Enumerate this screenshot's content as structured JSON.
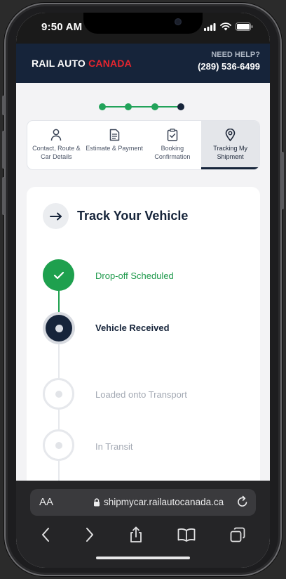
{
  "status_bar": {
    "time": "9:50 AM"
  },
  "header": {
    "logo_part1": "RAIL AUTO",
    "logo_part2": "CANADA",
    "help_label": "NEED HELP?",
    "phone": "(289) 536-6499",
    "accent_color": "#e5252f",
    "header_bg": "#16243a"
  },
  "progress": {
    "total_steps": 4,
    "current_step": 4
  },
  "steps": [
    {
      "label": "Contact, Route & Car Details",
      "icon": "person-icon"
    },
    {
      "label": "Estimate & Payment",
      "icon": "document-icon"
    },
    {
      "label": "Booking Confirmation",
      "icon": "clipboard-check-icon"
    },
    {
      "label": "Tracking My Shipment",
      "icon": "location-pin-icon",
      "active": true
    }
  ],
  "track": {
    "title": "Track Your Vehicle",
    "stages": [
      {
        "label": "Drop-off Scheduled",
        "status": "done"
      },
      {
        "label": "Vehicle Received",
        "status": "current"
      },
      {
        "label": "Loaded onto Transport",
        "status": "pending"
      },
      {
        "label": "In Transit",
        "status": "pending"
      }
    ]
  },
  "browser": {
    "text_size_label": "AA",
    "url": "shipmycar.railautocanada.ca"
  }
}
